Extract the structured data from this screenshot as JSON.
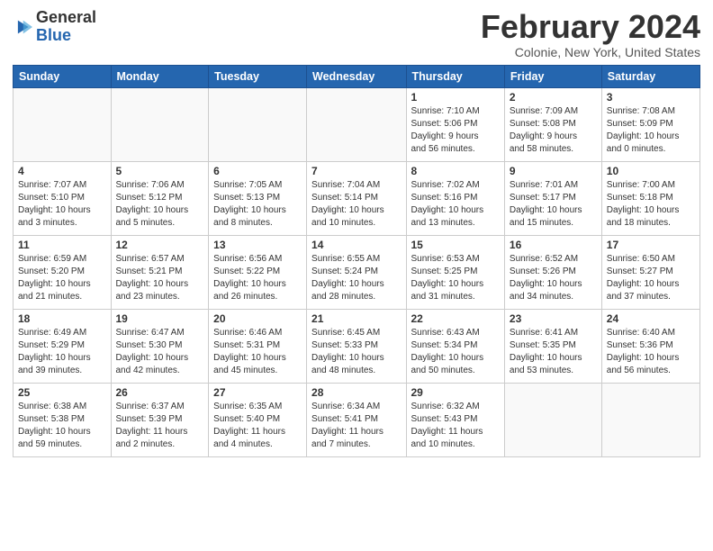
{
  "logo": {
    "general": "General",
    "blue": "Blue"
  },
  "title": "February 2024",
  "location": "Colonie, New York, United States",
  "weekdays": [
    "Sunday",
    "Monday",
    "Tuesday",
    "Wednesday",
    "Thursday",
    "Friday",
    "Saturday"
  ],
  "weeks": [
    [
      {
        "day": "",
        "detail": ""
      },
      {
        "day": "",
        "detail": ""
      },
      {
        "day": "",
        "detail": ""
      },
      {
        "day": "",
        "detail": ""
      },
      {
        "day": "1",
        "detail": "Sunrise: 7:10 AM\nSunset: 5:06 PM\nDaylight: 9 hours\nand 56 minutes."
      },
      {
        "day": "2",
        "detail": "Sunrise: 7:09 AM\nSunset: 5:08 PM\nDaylight: 9 hours\nand 58 minutes."
      },
      {
        "day": "3",
        "detail": "Sunrise: 7:08 AM\nSunset: 5:09 PM\nDaylight: 10 hours\nand 0 minutes."
      }
    ],
    [
      {
        "day": "4",
        "detail": "Sunrise: 7:07 AM\nSunset: 5:10 PM\nDaylight: 10 hours\nand 3 minutes."
      },
      {
        "day": "5",
        "detail": "Sunrise: 7:06 AM\nSunset: 5:12 PM\nDaylight: 10 hours\nand 5 minutes."
      },
      {
        "day": "6",
        "detail": "Sunrise: 7:05 AM\nSunset: 5:13 PM\nDaylight: 10 hours\nand 8 minutes."
      },
      {
        "day": "7",
        "detail": "Sunrise: 7:04 AM\nSunset: 5:14 PM\nDaylight: 10 hours\nand 10 minutes."
      },
      {
        "day": "8",
        "detail": "Sunrise: 7:02 AM\nSunset: 5:16 PM\nDaylight: 10 hours\nand 13 minutes."
      },
      {
        "day": "9",
        "detail": "Sunrise: 7:01 AM\nSunset: 5:17 PM\nDaylight: 10 hours\nand 15 minutes."
      },
      {
        "day": "10",
        "detail": "Sunrise: 7:00 AM\nSunset: 5:18 PM\nDaylight: 10 hours\nand 18 minutes."
      }
    ],
    [
      {
        "day": "11",
        "detail": "Sunrise: 6:59 AM\nSunset: 5:20 PM\nDaylight: 10 hours\nand 21 minutes."
      },
      {
        "day": "12",
        "detail": "Sunrise: 6:57 AM\nSunset: 5:21 PM\nDaylight: 10 hours\nand 23 minutes."
      },
      {
        "day": "13",
        "detail": "Sunrise: 6:56 AM\nSunset: 5:22 PM\nDaylight: 10 hours\nand 26 minutes."
      },
      {
        "day": "14",
        "detail": "Sunrise: 6:55 AM\nSunset: 5:24 PM\nDaylight: 10 hours\nand 28 minutes."
      },
      {
        "day": "15",
        "detail": "Sunrise: 6:53 AM\nSunset: 5:25 PM\nDaylight: 10 hours\nand 31 minutes."
      },
      {
        "day": "16",
        "detail": "Sunrise: 6:52 AM\nSunset: 5:26 PM\nDaylight: 10 hours\nand 34 minutes."
      },
      {
        "day": "17",
        "detail": "Sunrise: 6:50 AM\nSunset: 5:27 PM\nDaylight: 10 hours\nand 37 minutes."
      }
    ],
    [
      {
        "day": "18",
        "detail": "Sunrise: 6:49 AM\nSunset: 5:29 PM\nDaylight: 10 hours\nand 39 minutes."
      },
      {
        "day": "19",
        "detail": "Sunrise: 6:47 AM\nSunset: 5:30 PM\nDaylight: 10 hours\nand 42 minutes."
      },
      {
        "day": "20",
        "detail": "Sunrise: 6:46 AM\nSunset: 5:31 PM\nDaylight: 10 hours\nand 45 minutes."
      },
      {
        "day": "21",
        "detail": "Sunrise: 6:45 AM\nSunset: 5:33 PM\nDaylight: 10 hours\nand 48 minutes."
      },
      {
        "day": "22",
        "detail": "Sunrise: 6:43 AM\nSunset: 5:34 PM\nDaylight: 10 hours\nand 50 minutes."
      },
      {
        "day": "23",
        "detail": "Sunrise: 6:41 AM\nSunset: 5:35 PM\nDaylight: 10 hours\nand 53 minutes."
      },
      {
        "day": "24",
        "detail": "Sunrise: 6:40 AM\nSunset: 5:36 PM\nDaylight: 10 hours\nand 56 minutes."
      }
    ],
    [
      {
        "day": "25",
        "detail": "Sunrise: 6:38 AM\nSunset: 5:38 PM\nDaylight: 10 hours\nand 59 minutes."
      },
      {
        "day": "26",
        "detail": "Sunrise: 6:37 AM\nSunset: 5:39 PM\nDaylight: 11 hours\nand 2 minutes."
      },
      {
        "day": "27",
        "detail": "Sunrise: 6:35 AM\nSunset: 5:40 PM\nDaylight: 11 hours\nand 4 minutes."
      },
      {
        "day": "28",
        "detail": "Sunrise: 6:34 AM\nSunset: 5:41 PM\nDaylight: 11 hours\nand 7 minutes."
      },
      {
        "day": "29",
        "detail": "Sunrise: 6:32 AM\nSunset: 5:43 PM\nDaylight: 11 hours\nand 10 minutes."
      },
      {
        "day": "",
        "detail": ""
      },
      {
        "day": "",
        "detail": ""
      }
    ]
  ]
}
